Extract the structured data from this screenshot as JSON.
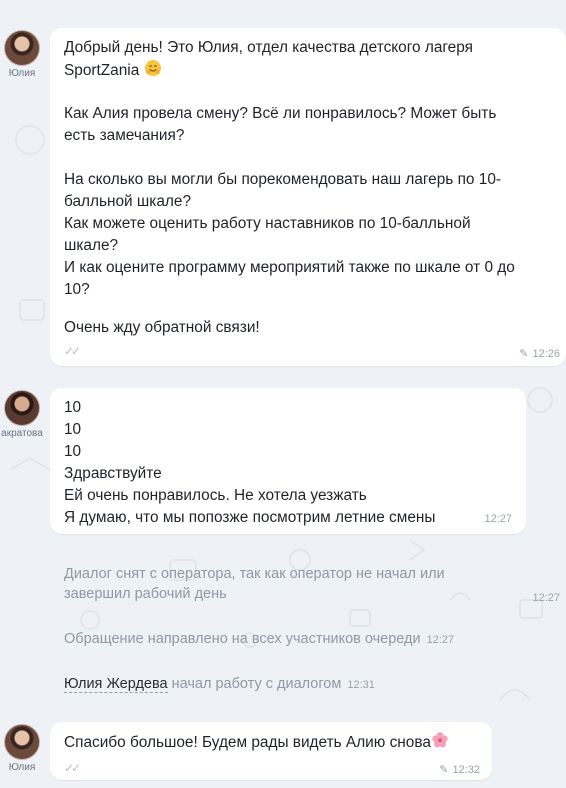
{
  "messages": [
    {
      "author": "Юлия",
      "text": "Добрый день! Это Юлия, отдел качества детского лагеря\nSportZania",
      "text2": "Как Алия провела смену? Всё ли понравилось? Может быть\nесть замечания?",
      "text3": "На сколько вы могли бы порекомендовать наш лагерь по 10-\nбалльной шкале?\nКак можете оценить работу наставников по 10-балльной\nшкале?\nИ как оцените программу мероприятий также по шкале от 0 до\n10?",
      "text4": "Очень жду обратной связи!",
      "time": "12:26",
      "emoji_icon": "smiling-hugging-face"
    },
    {
      "author": "акратова",
      "text": "10\n10\n10\nЗдравствуйте\nЕй очень понравилось. Не хотела уезжать\nЯ думаю, что мы попозже посмотрим летние смены",
      "time": "12:27"
    },
    {
      "author": "Юлия",
      "text": "Спасибо большое! Будем рады видеть Алию снова",
      "time": "12:32",
      "emoji_icon": "cherry-blossom"
    }
  ],
  "system": {
    "operator_removed": "Диалог снят с оператора, так как оператор не начал или\nзавершил рабочий день",
    "operator_removed_time": "12:27",
    "queue_sent": "Обращение направлено на всех участников очереди",
    "queue_sent_time": "12:27",
    "agent_name": "Юлия Жердева",
    "agent_started": "начал работу с диалогом",
    "agent_started_time": "12:31"
  },
  "colors": {
    "background": "#eef1f5",
    "bubble": "#ffffff",
    "muted": "#9aa3ad"
  }
}
